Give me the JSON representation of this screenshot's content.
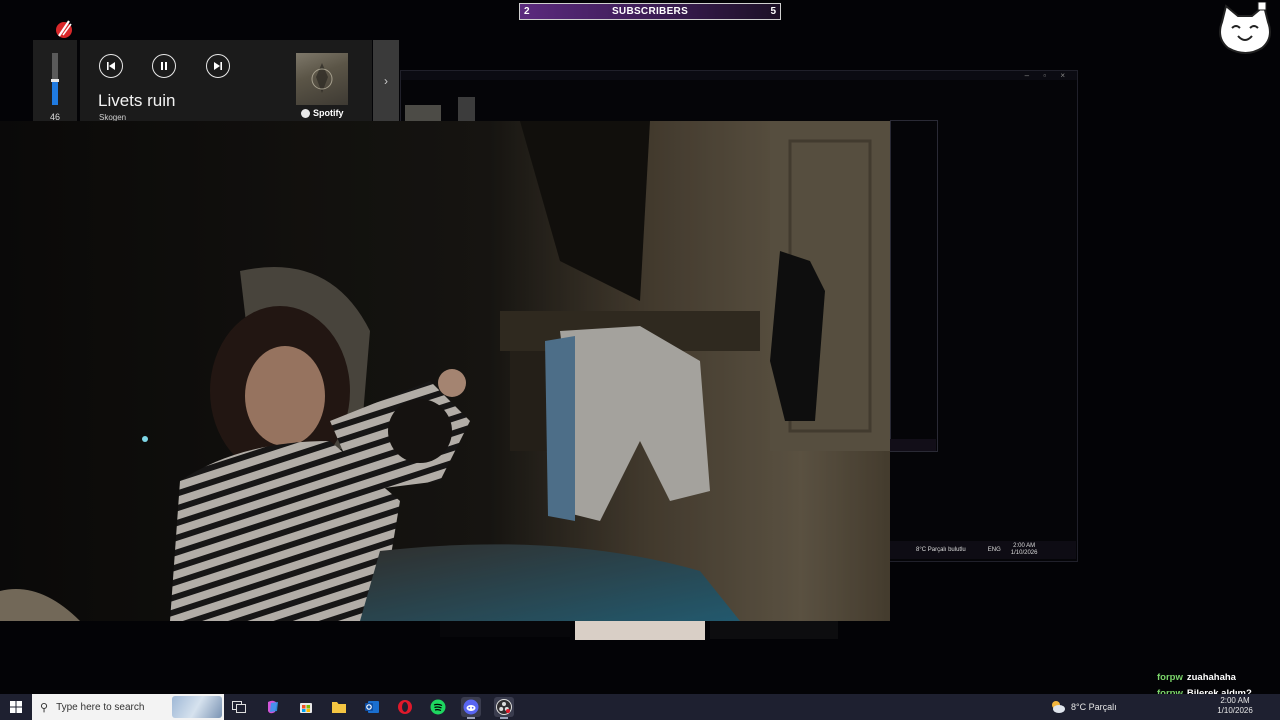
{
  "subscriber_goal": {
    "current": "2",
    "label": "SUBSCRIBERS",
    "target": "5"
  },
  "media": {
    "volume": "46",
    "volume_fraction": 0.46,
    "track_title": "Livets ruin",
    "artist": "Skogen",
    "source": "Spotify"
  },
  "inner_taskbar": {
    "weather": "8°C  Parçalı bulutlu",
    "lang": "ENG",
    "time": "2:00 AM",
    "date": "1/10/2026"
  },
  "chat": [
    {
      "user": "forpw",
      "message": "zuahahaha"
    },
    {
      "user": "forpw",
      "message": "Bilerek aldım?"
    }
  ],
  "taskbar": {
    "search_placeholder": "Type here to search",
    "weather": "8°C  Parçalı",
    "time": "2:00 AM",
    "date": "1/10/2026",
    "pinned": [
      "task-view-icon",
      "copilot-icon",
      "store-icon",
      "file-explorer-icon",
      "outlook-icon",
      "opera-icon",
      "spotify-icon",
      "discord-icon",
      "obs-icon"
    ]
  },
  "colors": {
    "accent_purple": "#5b2a7e",
    "volume_blue": "#1f7ae0",
    "chat_user_green": "#7cd66b",
    "taskbar": "#1e2030"
  }
}
